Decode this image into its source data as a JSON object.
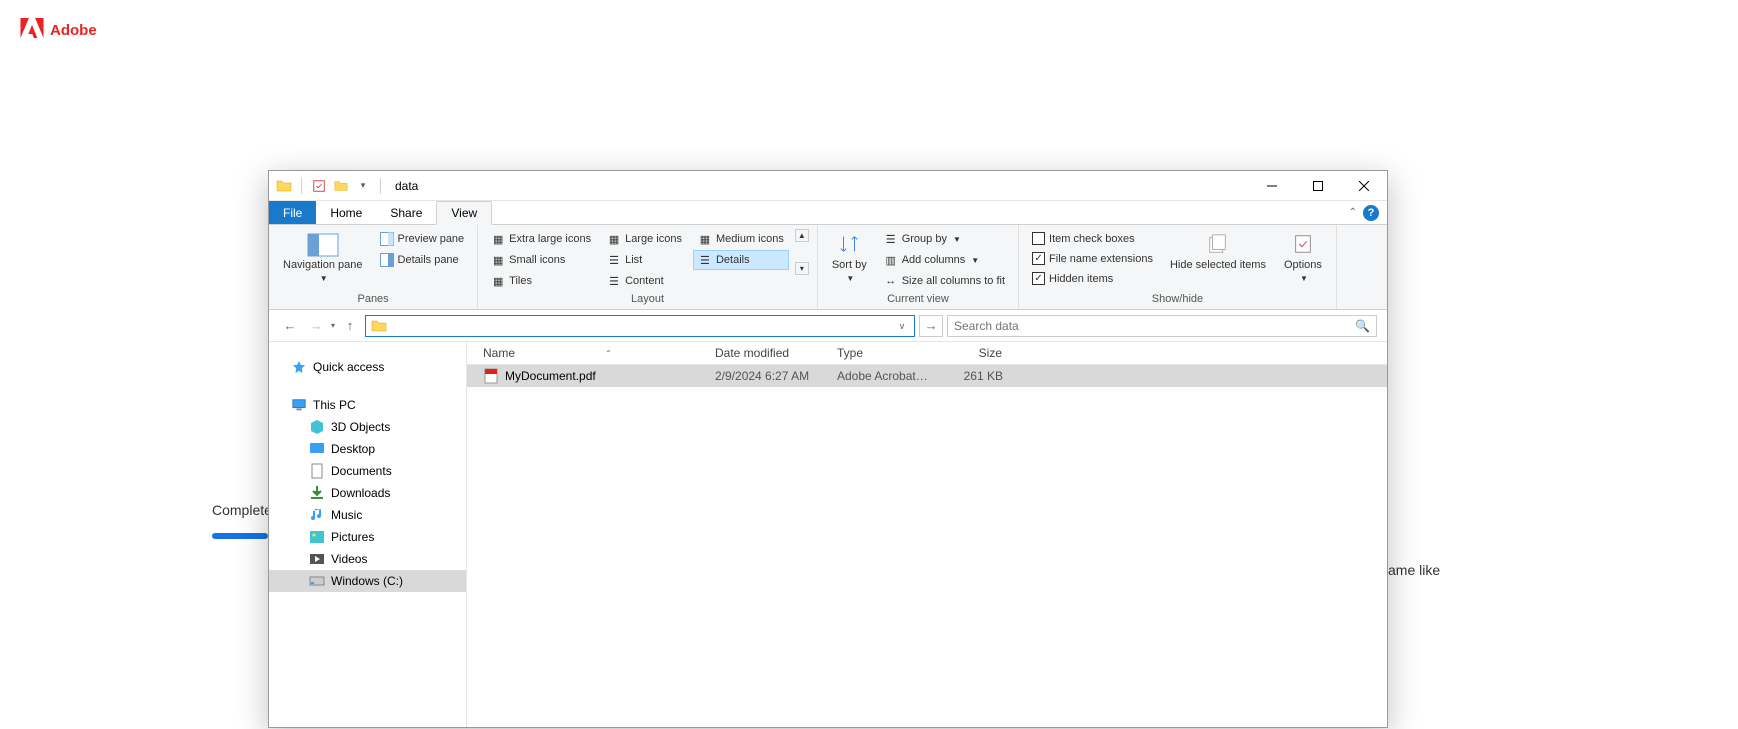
{
  "adobe": {
    "label": "Adobe"
  },
  "background": {
    "complete": "Complete",
    "fragment": "ame like"
  },
  "titlebar": {
    "title": "data"
  },
  "tabs": {
    "file": "File",
    "home": "Home",
    "share": "Share",
    "view": "View"
  },
  "ribbon": {
    "panes": {
      "nav": "Navigation pane",
      "preview": "Preview pane",
      "details": "Details pane",
      "label": "Panes"
    },
    "layout": {
      "xl": "Extra large icons",
      "large": "Large icons",
      "medium": "Medium icons",
      "small": "Small icons",
      "list": "List",
      "details": "Details",
      "tiles": "Tiles",
      "content": "Content",
      "label": "Layout"
    },
    "current": {
      "sort": "Sort by",
      "group": "Group by",
      "addcols": "Add columns",
      "sizeall": "Size all columns to fit",
      "label": "Current view"
    },
    "showhide": {
      "itemcheck": "Item check boxes",
      "ext": "File name extensions",
      "hidden": "Hidden items",
      "hidesel": "Hide selected items",
      "options": "Options",
      "label": "Show/hide"
    }
  },
  "address": {
    "value": "",
    "search_placeholder": "Search data"
  },
  "tree": {
    "quick": "Quick access",
    "thispc": "This PC",
    "children": [
      "3D Objects",
      "Desktop",
      "Documents",
      "Downloads",
      "Music",
      "Pictures",
      "Videos",
      "Windows (C:)"
    ]
  },
  "columns": {
    "name": "Name",
    "date": "Date modified",
    "type": "Type",
    "size": "Size"
  },
  "rows": [
    {
      "name": "MyDocument.pdf",
      "date": "2/9/2024 6:27 AM",
      "type": "Adobe Acrobat D...",
      "size": "261 KB"
    }
  ]
}
